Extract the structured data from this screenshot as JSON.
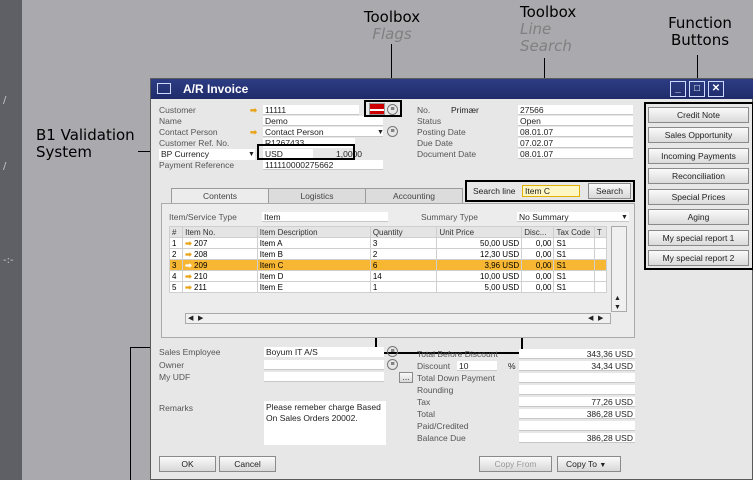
{
  "annotations": {
    "flags": {
      "title": "Toolbox",
      "sub": "Flags"
    },
    "line_search": {
      "title": "Toolbox",
      "sub": "Line Search"
    },
    "function_buttons": "Function\nButtons",
    "validation": "B1 Validation\nSystem"
  },
  "window": {
    "title": "A/R Invoice"
  },
  "header": {
    "customer_label": "Customer",
    "customer_value": "11111",
    "name_label": "Name",
    "name_value": "Demo",
    "contact_label": "Contact Person",
    "contact_value": "Contact Person",
    "custref_label": "Customer Ref. No.",
    "custref_value": "R1267433",
    "currency_label": "BP Currency",
    "currency_value": "USD",
    "rate_value": "1,0000",
    "payref_label": "Payment Reference",
    "payref_value": "111110000275662",
    "no_label": "No.",
    "series_value": "Primær",
    "no_value": "27566",
    "status_label": "Status",
    "status_value": "Open",
    "posting_label": "Posting Date",
    "posting_value": "08.01.07",
    "due_label": "Due Date",
    "due_value": "07.02.07",
    "docdate_label": "Document Date",
    "docdate_value": "08.01.07"
  },
  "tabs": [
    "Contents",
    "Logistics",
    "Accounting"
  ],
  "search": {
    "label": "Search line",
    "value": "Item C",
    "button": "Search"
  },
  "contents": {
    "type_label": "Item/Service Type",
    "type_value": "Item",
    "summary_label": "Summary Type",
    "summary_value": "No Summary",
    "columns": [
      "#",
      "Item No.",
      "Item Description",
      "Quantity",
      "Unit Price",
      "Disc...",
      "Tax Code",
      "T"
    ],
    "rows": [
      {
        "n": "1",
        "item": "207",
        "desc": "Item A",
        "qty": "3",
        "price": "50,00 USD",
        "disc": "0,00",
        "tax": "S1"
      },
      {
        "n": "2",
        "item": "208",
        "desc": "Item B",
        "qty": "2",
        "price": "12,30 USD",
        "disc": "0,00",
        "tax": "S1"
      },
      {
        "n": "3",
        "item": "209",
        "desc": "Item C",
        "qty": "6",
        "price": "3,96 USD",
        "disc": "0,00",
        "tax": "S1"
      },
      {
        "n": "4",
        "item": "210",
        "desc": "Item D",
        "qty": "14",
        "price": "10,00 USD",
        "disc": "0,00",
        "tax": "S1"
      },
      {
        "n": "5",
        "item": "211",
        "desc": "Item E",
        "qty": "1",
        "price": "5,00 USD",
        "disc": "0,00",
        "tax": "S1"
      }
    ],
    "selected_row": 2
  },
  "footer": {
    "sales_emp_label": "Sales Employee",
    "sales_emp_value": "Boyum IT A/S",
    "owner_label": "Owner",
    "udf_label": "My UDF",
    "udf_btn": "...",
    "remarks_label": "Remarks",
    "remarks_value": "Please remeber charge Based On Sales Orders 20002.",
    "tbd_label": "Total Before Discount",
    "tbd_value": "343,36 USD",
    "discount_label": "Discount",
    "discount_pct": "10",
    "pct_sign": "%",
    "discount_value": "34,34 USD",
    "tdp_label": "Total Down Payment",
    "rounding_label": "Rounding",
    "tax_label": "Tax",
    "tax_value": "77,26 USD",
    "total_label": "Total",
    "total_value": "386,28 USD",
    "paid_label": "Paid/Credited",
    "balance_label": "Balance Due",
    "balance_value": "386,28 USD"
  },
  "buttons": {
    "ok": "OK",
    "cancel": "Cancel",
    "copy_from": "Copy From",
    "copy_to": "Copy To"
  },
  "function_buttons": [
    "Credit Note",
    "Sales Opportunity",
    "Incoming Payments",
    "Reconciliation",
    "Special Prices",
    "Aging",
    "My special report 1",
    "My special report 2"
  ]
}
